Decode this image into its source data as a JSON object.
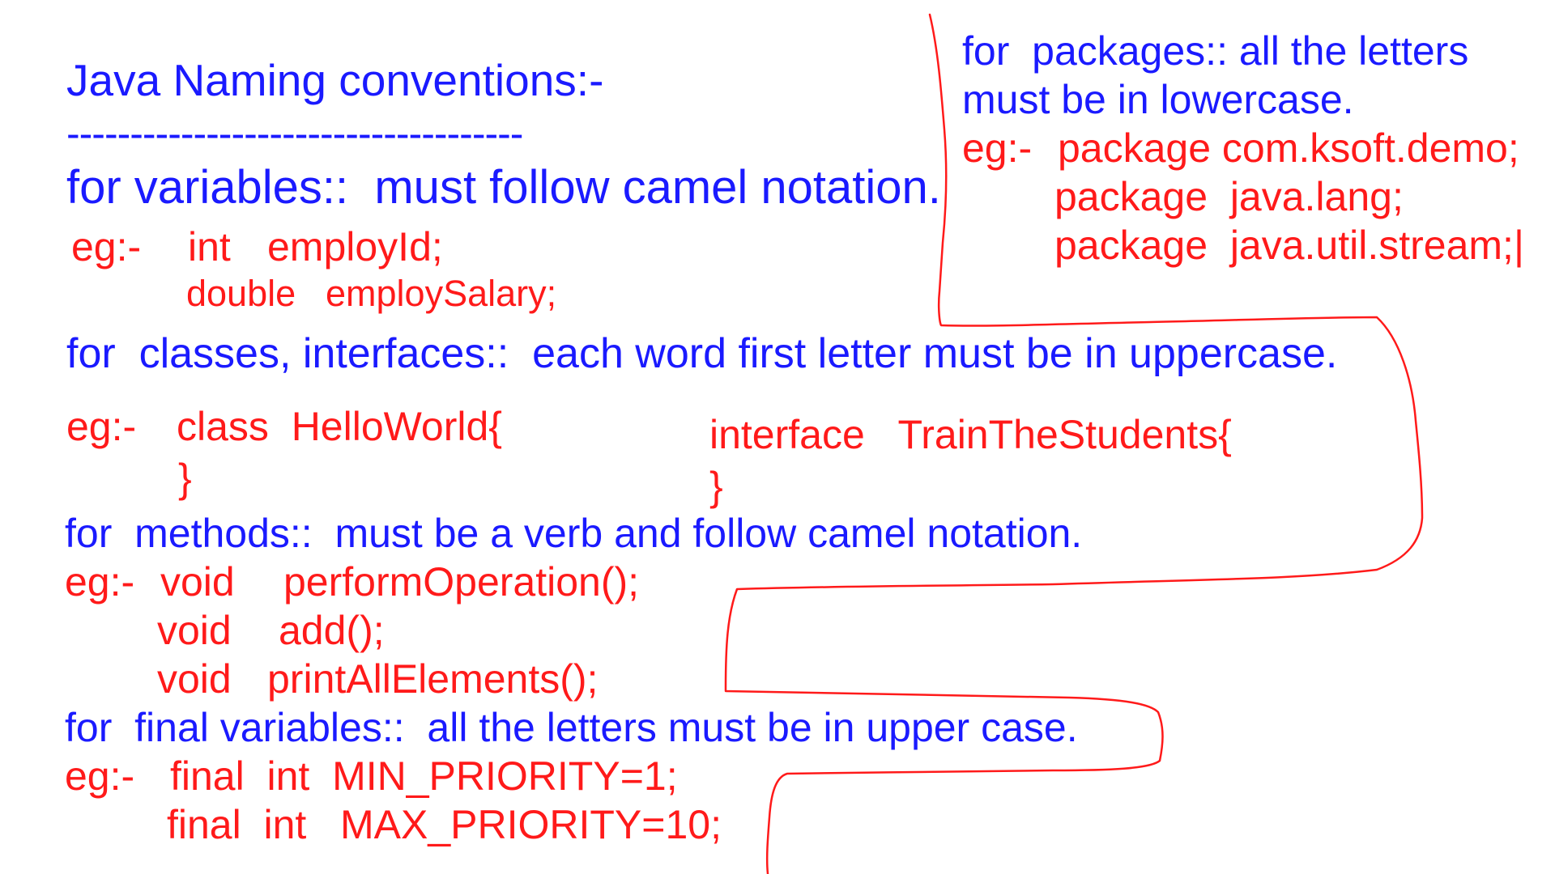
{
  "title": "Java Naming conventions:-",
  "title_rule": "------------------------------------",
  "variables": {
    "heading": "for variables::  must follow camel notation.",
    "eg_label": "eg:-",
    "line1_type": "int",
    "line1_name": "employId;",
    "line2_type": "double",
    "line2_name": "employSalary;"
  },
  "packages": {
    "heading_line1": "for  packages:: all the letters",
    "heading_line2": "must be in lowercase.",
    "eg_label": "eg:-",
    "line1": "package com.ksoft.demo;",
    "line2": "package  java.lang;",
    "line3": "package  java.util.stream;|"
  },
  "classes": {
    "heading": "for  classes, interfaces::  each word first letter must be in uppercase.",
    "eg_label": "eg:-",
    "class_decl": "class  HelloWorld{",
    "class_close": "}",
    "interface_decl": "interface   TrainTheStudents{",
    "interface_close": "}"
  },
  "methods": {
    "heading": "for  methods::  must be a verb and follow camel notation.",
    "eg_label": "eg:-",
    "line1_type": "void",
    "line1_name": "performOperation();",
    "line2_type": "void",
    "line2_name": "add();",
    "line3_type": "void",
    "line3_name": "printAllElements();"
  },
  "finals": {
    "heading": "for  final variables::  all the letters must be in upper case.",
    "eg_label": "eg:-",
    "line1": "final  int  MIN_PRIORITY=1;",
    "line2": "final  int   MAX_PRIORITY=10;"
  },
  "colors": {
    "heading": "#1a1aff",
    "example": "#ff1a1a",
    "ink_line": "#ff1a1a",
    "background": "#ffffff"
  }
}
